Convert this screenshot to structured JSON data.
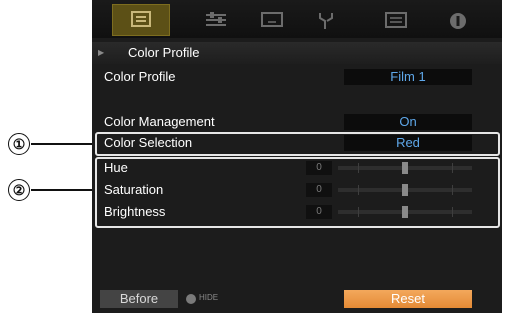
{
  "breadcrumb": {
    "title": "Color Profile"
  },
  "rows": {
    "color_profile": {
      "label": "Color Profile",
      "value": "Film 1"
    },
    "color_management": {
      "label": "Color Management",
      "value": "On"
    },
    "color_selection": {
      "label": "Color Selection",
      "value": "Red"
    }
  },
  "adjust": [
    {
      "label": "Hue",
      "value": "0",
      "level": 0.5
    },
    {
      "label": "Saturation",
      "value": "0",
      "level": 0.5
    },
    {
      "label": "Brightness",
      "value": "0",
      "level": 0.5
    }
  ],
  "footer": {
    "before_label": "Before",
    "hide_label": "HIDE",
    "reset_label": "Reset"
  },
  "callouts": {
    "one": "①",
    "two": "②"
  },
  "colors": {
    "value_text": "#5fa8ea",
    "reset_button": "#e48a35",
    "active_tab": "#5c5016"
  },
  "icons": [
    "picture-tab-icon",
    "adjust-tab-icon",
    "input-tab-icon",
    "installation-tab-icon",
    "function-tab-icon",
    "info-tab-icon"
  ]
}
